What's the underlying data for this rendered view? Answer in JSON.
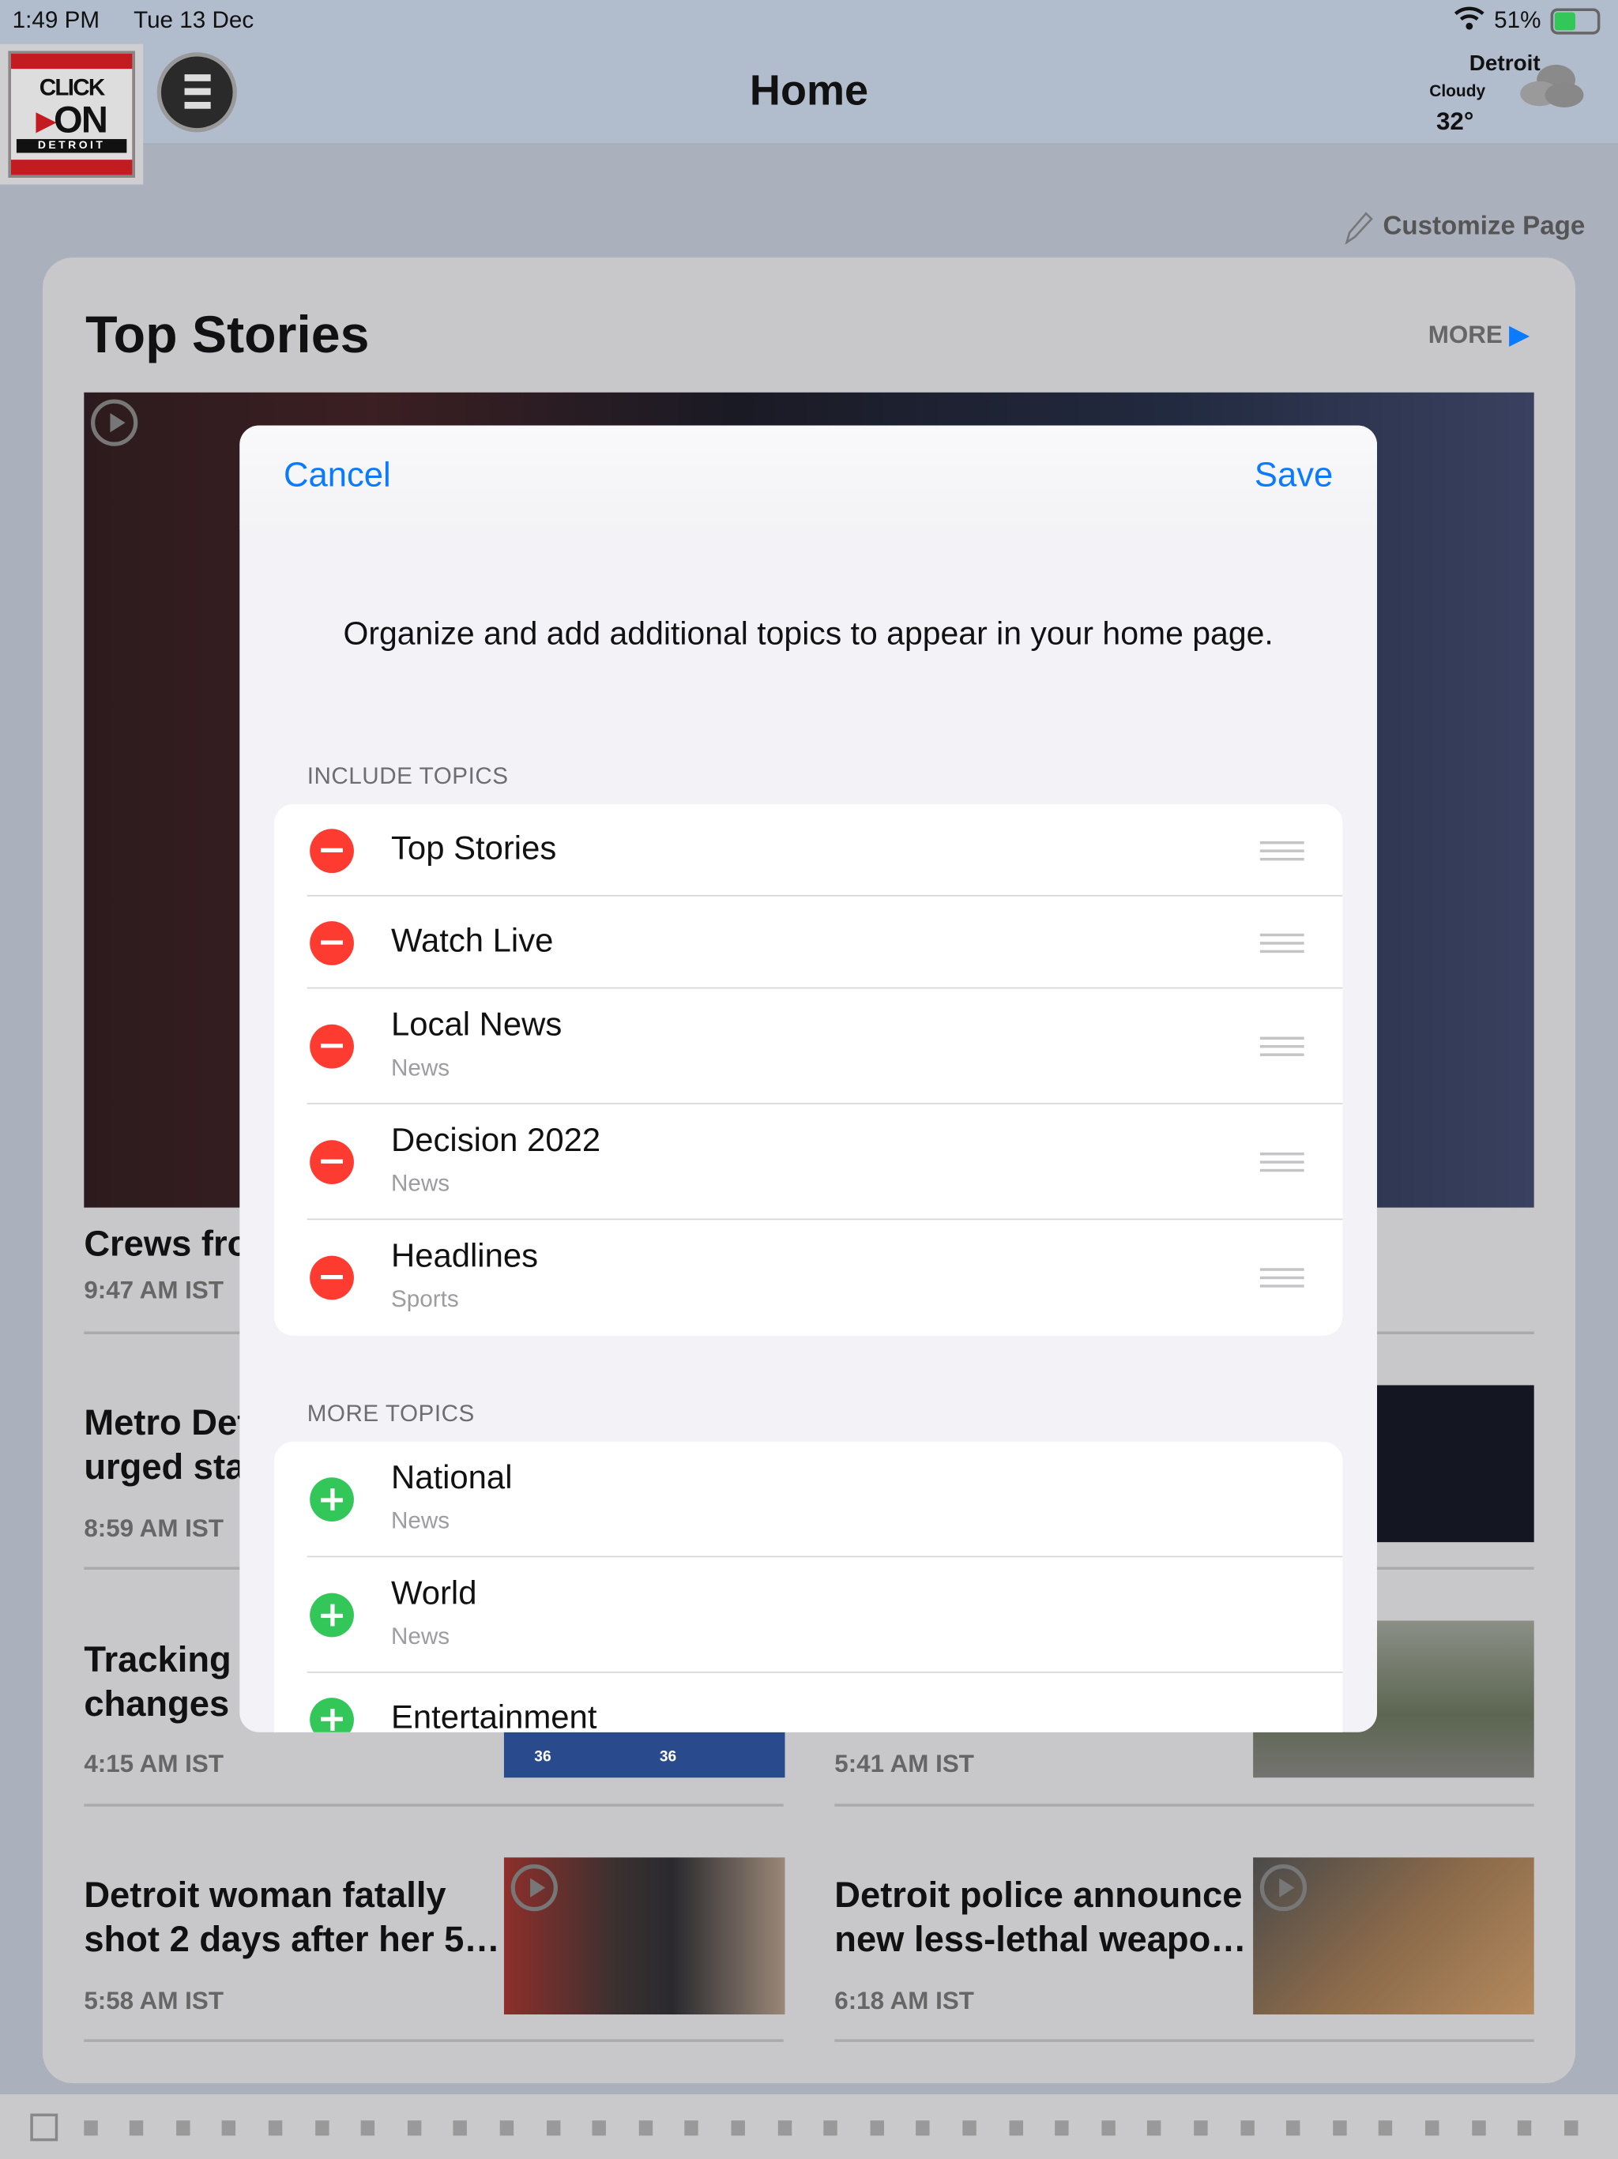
{
  "status_bar": {
    "time": "1:49 PM",
    "date": "Tue 13 Dec",
    "battery": "51%",
    "battery_level": 51,
    "charging": true
  },
  "header": {
    "title": "Home",
    "logo_text": [
      "CLICK",
      "ON",
      "DETROIT"
    ],
    "menu_icon": "hamburger-icon"
  },
  "weather": {
    "city": "Detroit",
    "condition": "Cloudy",
    "temp": "32°",
    "icon": "cloud-icon"
  },
  "customize_label": "Customize Page",
  "top_stories": {
    "title": "Top Stories",
    "more_label": "MORE",
    "articles": [
      {
        "title": "Crews fror",
        "time": "9:47 AM IST"
      },
      {
        "title": "Metro Detr\nurged stat",
        "time": "8:59 AM IST"
      },
      {
        "title": "Tracking b\nchanges ir",
        "time": "4:15 AM IST"
      },
      {
        "title": "",
        "time": "5:41 AM IST"
      },
      {
        "title": "Detroit woman fatally\nshot 2 days after her 5…",
        "time": "5:58 AM IST"
      },
      {
        "title": "Detroit police announce\nnew less-lethal weapo…",
        "time": "6:18 AM IST"
      }
    ],
    "map_labels": [
      "36",
      "36"
    ]
  },
  "modal": {
    "cancel_label": "Cancel",
    "save_label": "Save",
    "description": "Organize and add additional topics to appear in your home page.",
    "include_header": "INCLUDE TOPICS",
    "include": [
      {
        "label": "Top Stories",
        "sub": ""
      },
      {
        "label": "Watch Live",
        "sub": ""
      },
      {
        "label": "Local News",
        "sub": "News"
      },
      {
        "label": "Decision 2022",
        "sub": "News"
      },
      {
        "label": "Headlines",
        "sub": "Sports"
      }
    ],
    "more_header": "MORE TOPICS",
    "more": [
      {
        "label": "National",
        "sub": "News"
      },
      {
        "label": "World",
        "sub": "News"
      },
      {
        "label": "Entertainment",
        "sub": ""
      }
    ]
  },
  "colors": {
    "accent": "#0a7aff",
    "remove": "#fe3b30",
    "add": "#33c759"
  }
}
